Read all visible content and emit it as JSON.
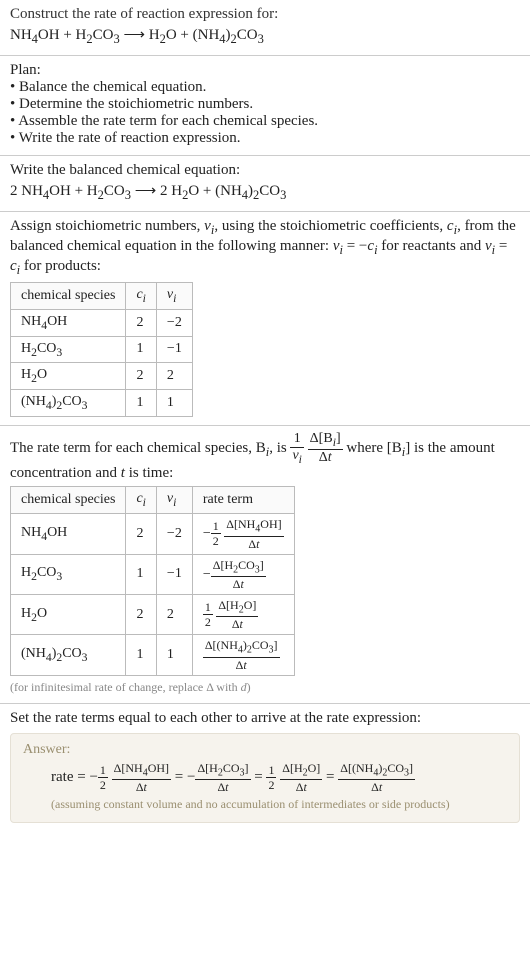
{
  "q": {
    "prompt": "Construct the rate of reaction expression for:",
    "equation_html": "NH<sub>4</sub>OH + H<sub>2</sub>CO<sub>3</sub> ⟶ H<sub>2</sub>O + (NH<sub>4</sub>)<sub>2</sub>CO<sub>3</sub>"
  },
  "plan": {
    "heading": "Plan:",
    "items": [
      "Balance the chemical equation.",
      "Determine the stoichiometric numbers.",
      "Assemble the rate term for each chemical species.",
      "Write the rate of reaction expression."
    ]
  },
  "balanced": {
    "heading": "Write the balanced chemical equation:",
    "equation_html": "2 NH<sub>4</sub>OH + H<sub>2</sub>CO<sub>3</sub> ⟶ 2 H<sub>2</sub>O + (NH<sub>4</sub>)<sub>2</sub>CO<sub>3</sub>"
  },
  "stoich": {
    "text_html": "Assign stoichiometric numbers, <i>ν<sub>i</sub></i>, using the stoichiometric coefficients, <i>c<sub>i</sub></i>, from the balanced chemical equation in the following manner: <i>ν<sub>i</sub></i> = −<i>c<sub>i</sub></i> for reactants and <i>ν<sub>i</sub></i> = <i>c<sub>i</sub></i> for products:",
    "headers": {
      "species": "chemical species",
      "c": "c_i",
      "v": "ν_i"
    },
    "rows": [
      {
        "species_html": "NH<sub>4</sub>OH",
        "c": "2",
        "v": "−2"
      },
      {
        "species_html": "H<sub>2</sub>CO<sub>3</sub>",
        "c": "1",
        "v": "−1"
      },
      {
        "species_html": "H<sub>2</sub>O",
        "c": "2",
        "v": "2"
      },
      {
        "species_html": "(NH<sub>4</sub>)<sub>2</sub>CO<sub>3</sub>",
        "c": "1",
        "v": "1"
      }
    ]
  },
  "rateterm": {
    "text_html": "The rate term for each chemical species, B<sub><i>i</i></sub>, is <span class=\"frac bigfrac\"><span class=\"num\">1</span><span class=\"den\"><i>ν<sub>i</sub></i></span></span> <span class=\"frac bigfrac\"><span class=\"num\">Δ[B<sub><i>i</i></sub>]</span><span class=\"den\">Δ<i>t</i></span></span> where [B<sub><i>i</i></sub>] is the amount concentration and <i>t</i> is time:",
    "headers": {
      "species": "chemical species",
      "c": "c_i",
      "v": "ν_i",
      "rate": "rate term"
    },
    "rows": [
      {
        "species_html": "NH<sub>4</sub>OH",
        "c": "2",
        "v": "−2",
        "rate_html": "−<span class=\"frac\"><span class=\"num\">1</span><span class=\"den\">2</span></span> <span class=\"frac\"><span class=\"num\">Δ[NH<sub>4</sub>OH]</span><span class=\"den\">Δ<i>t</i></span></span>"
      },
      {
        "species_html": "H<sub>2</sub>CO<sub>3</sub>",
        "c": "1",
        "v": "−1",
        "rate_html": "−<span class=\"frac\"><span class=\"num\">Δ[H<sub>2</sub>CO<sub>3</sub>]</span><span class=\"den\">Δ<i>t</i></span></span>"
      },
      {
        "species_html": "H<sub>2</sub>O",
        "c": "2",
        "v": "2",
        "rate_html": "<span class=\"frac\"><span class=\"num\">1</span><span class=\"den\">2</span></span> <span class=\"frac\"><span class=\"num\">Δ[H<sub>2</sub>O]</span><span class=\"den\">Δ<i>t</i></span></span>"
      },
      {
        "species_html": "(NH<sub>4</sub>)<sub>2</sub>CO<sub>3</sub>",
        "c": "1",
        "v": "1",
        "rate_html": "<span class=\"frac\"><span class=\"num\">Δ[(NH<sub>4</sub>)<sub>2</sub>CO<sub>3</sub>]</span><span class=\"den\">Δ<i>t</i></span></span>"
      }
    ],
    "note_html": "(for infinitesimal rate of change, replace Δ with <i>d</i>)"
  },
  "final": {
    "heading": "Set the rate terms equal to each other to arrive at the rate expression:",
    "answer_label": "Answer:",
    "expr_html": "rate = −<span class=\"frac\"><span class=\"num\">1</span><span class=\"den\">2</span></span> <span class=\"frac\"><span class=\"num\">Δ[NH<sub>4</sub>OH]</span><span class=\"den\">Δ<i>t</i></span></span> = −<span class=\"frac\"><span class=\"num\">Δ[H<sub>2</sub>CO<sub>3</sub>]</span><span class=\"den\">Δ<i>t</i></span></span> = <span class=\"frac\"><span class=\"num\">1</span><span class=\"den\">2</span></span> <span class=\"frac\"><span class=\"num\">Δ[H<sub>2</sub>O]</span><span class=\"den\">Δ<i>t</i></span></span> = <span class=\"frac\"><span class=\"num\">Δ[(NH<sub>4</sub>)<sub>2</sub>CO<sub>3</sub>]</span><span class=\"den\">Δ<i>t</i></span></span>",
    "assumption": "(assuming constant volume and no accumulation of intermediates or side products)"
  }
}
